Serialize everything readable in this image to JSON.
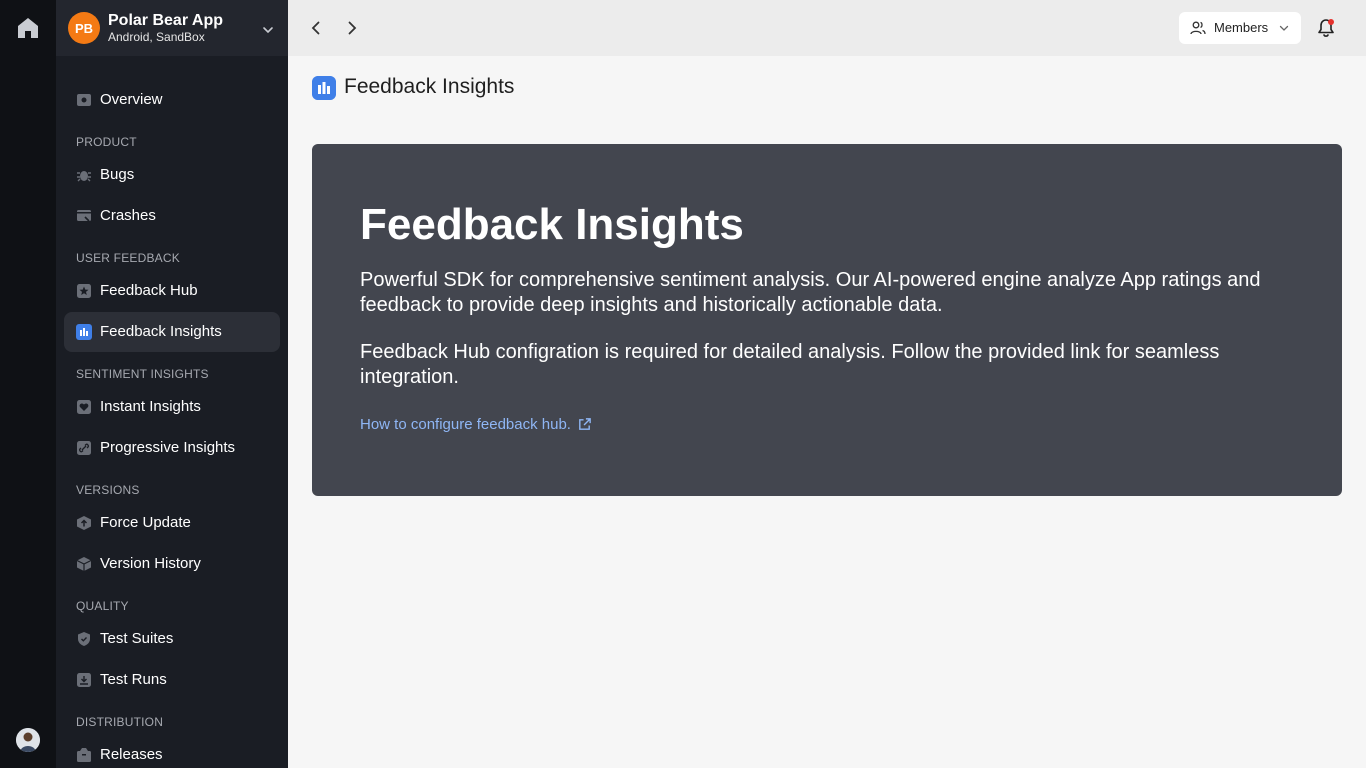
{
  "app": {
    "initials": "PB",
    "name": "Polar Bear App",
    "platform": "Android, SandBox"
  },
  "sidebar": {
    "overview": "Overview",
    "sections": {
      "product": "PRODUCT",
      "user_feedback": "USER FEEDBACK",
      "sentiment": "SENTIMENT INSIGHTS",
      "versions": "VERSIONS",
      "quality": "QUALITY",
      "distribution": "DISTRIBUTION"
    },
    "items": {
      "bugs": "Bugs",
      "crashes": "Crashes",
      "feedback_hub": "Feedback Hub",
      "feedback_insights": "Feedback Insights",
      "instant_insights": "Instant Insights",
      "progressive_insights": "Progressive Insights",
      "force_update": "Force Update",
      "version_history": "Version History",
      "test_suites": "Test Suites",
      "test_runs": "Test Runs",
      "releases": "Releases"
    },
    "active_item": "feedback_insights"
  },
  "topbar": {
    "members_label": "Members"
  },
  "main": {
    "page_title": "Feedback Insights",
    "card": {
      "title": "Feedback Insights",
      "paragraph1": "Powerful SDK for comprehensive sentiment analysis. Our AI-powered engine analyze App ratings and feedback to provide deep insights and historically actionable data.",
      "paragraph2": "Feedback Hub configration is required for detailed analysis. Follow the provided link for seamless integration.",
      "link": "How to configure feedback hub."
    }
  },
  "colors": {
    "accent": "#3f7fe8",
    "badge": "#f47a14",
    "card_bg": "#43464f",
    "link": "#8fb6f5",
    "notification_dot": "#e5322d"
  }
}
